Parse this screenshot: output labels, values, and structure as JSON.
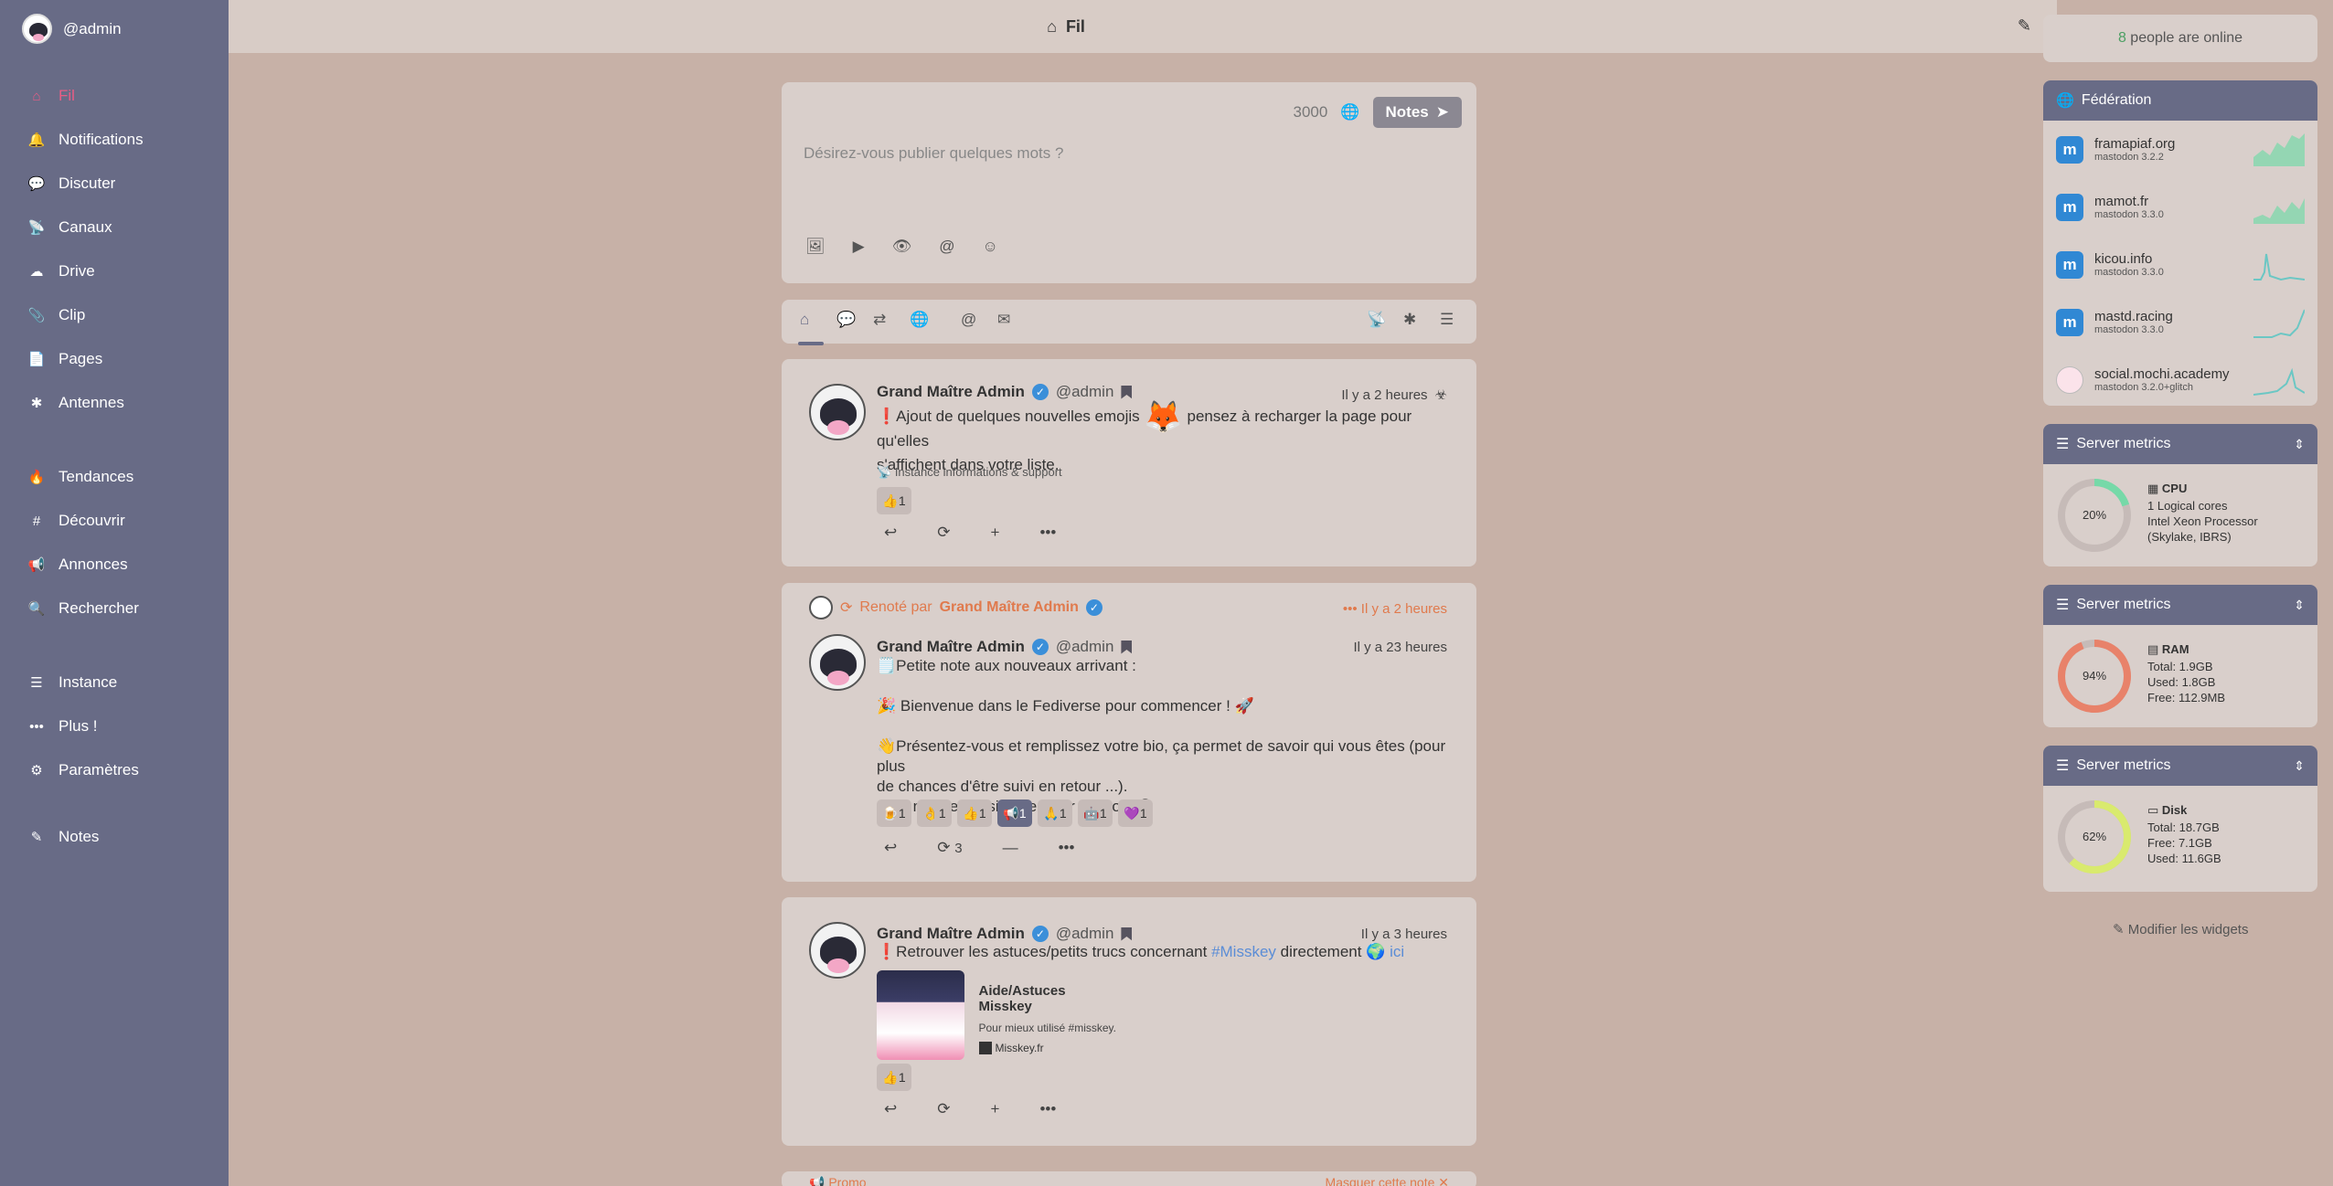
{
  "sidebar": {
    "account": "@admin",
    "items": [
      {
        "label": "Fil",
        "icon": "home-icon",
        "glyph": "⌂"
      },
      {
        "label": "Notifications",
        "icon": "bell-icon",
        "glyph": "🔔"
      },
      {
        "label": "Discuter",
        "icon": "chat-icon",
        "glyph": "💬"
      },
      {
        "label": "Canaux",
        "icon": "satellite-icon",
        "glyph": "📡"
      },
      {
        "label": "Drive",
        "icon": "cloud-icon",
        "glyph": "☁"
      },
      {
        "label": "Clip",
        "icon": "paperclip-icon",
        "glyph": "📎"
      },
      {
        "label": "Pages",
        "icon": "file-icon",
        "glyph": "📄"
      },
      {
        "label": "Antennes",
        "icon": "antenna-icon",
        "glyph": "✱"
      },
      {
        "label": "Tendances",
        "icon": "fire-icon",
        "glyph": "🔥"
      },
      {
        "label": "Découvrir",
        "icon": "hashtag-icon",
        "glyph": "#"
      },
      {
        "label": "Annonces",
        "icon": "broadcast-icon",
        "glyph": "📢"
      },
      {
        "label": "Rechercher",
        "icon": "search-icon",
        "glyph": "🔍"
      },
      {
        "label": "Instance",
        "icon": "server-icon",
        "glyph": "☰"
      },
      {
        "label": "Plus !",
        "icon": "more-icon",
        "glyph": "•••"
      },
      {
        "label": "Paramètres",
        "icon": "gear-icon",
        "glyph": "⚙"
      },
      {
        "label": "Notes",
        "icon": "pencil-icon",
        "glyph": "✎"
      }
    ]
  },
  "header": {
    "title": "Fil",
    "home_glyph": "⌂",
    "pencil_glyph": "✎"
  },
  "composer": {
    "chars": "3000",
    "globe": "🌐",
    "button": "Notes",
    "send": "➤",
    "placeholder": "Désirez-vous publier quelques mots ?",
    "tools": [
      "🖼",
      "▶",
      "👁",
      "@",
      "☺"
    ]
  },
  "timeline_tabs": {
    "glyphs": [
      "⌂",
      "💬",
      "⇄",
      "🌐",
      "@",
      "✉",
      "📡",
      "✱",
      "☰"
    ]
  },
  "notes": [
    {
      "name": "Grand Maître Admin",
      "handle": "@admin",
      "time": "Il y a 2 heures",
      "time_icon": "☣",
      "text_a": "❗Ajout de quelques nouvelles emojis",
      "emoji": "🦊",
      "text_b": "pensez à recharger la page pour qu'elles",
      "text_c": "s'affichent dans votre liste.",
      "channel": "Instance informations & support",
      "reaction": "👍1"
    },
    {
      "renote_label": "Renoté par",
      "renote_by": "Grand Maître Admin",
      "renote_time": "••• Il y a 2 heures",
      "name": "Grand Maître Admin",
      "handle": "@admin",
      "time": "Il y a 23 heures",
      "lines": [
        "🗒️Petite note aux nouveaux arrivant :",
        "",
        "🎉 Bienvenue dans le Fediverse pour commencer ! 🚀",
        "",
        "👋Présentez-vous et remplissez votre bio, ça permet de savoir qui vous êtes (pour plus",
        "de chances d'être suivi en retour ...).",
        "Cela m'aide aussi à identifier les bots 😉"
      ],
      "reactions": [
        "🍺1",
        "👌1",
        "👍1",
        "📢1",
        "🙏1",
        "🤖1",
        "💜1"
      ],
      "renote_count": "3"
    },
    {
      "name": "Grand Maître Admin",
      "handle": "@admin",
      "time": "Il y a 3 heures",
      "text_a": "❗Retrouver les astuces/petits trucs concernant",
      "hashtag": "#Misskey",
      "text_b": "directement",
      "link": "🌍 ici",
      "card_title": "Aide/Astuces Misskey",
      "card_desc": "Pour mieux utilisé #misskey.",
      "card_site": "Misskey.fr",
      "reaction": "👍1"
    }
  ],
  "banner": {
    "left": "📢 Promo",
    "right": "Masquer cette note ✕"
  },
  "widgets": {
    "online_count": "8",
    "online_text": "people are online",
    "federation_title": "Fédération",
    "federation": [
      {
        "name": "framapiaf.org",
        "version": "mastodon 3.2.2",
        "color": "#76d9a8"
      },
      {
        "name": "mamot.fr",
        "version": "mastodon 3.3.0",
        "color": "#76d9a8"
      },
      {
        "name": "kicou.info",
        "version": "mastodon 3.3.0",
        "color": "#6bc7c4"
      },
      {
        "name": "mastd.racing",
        "version": "mastodon 3.3.0",
        "color": "#6bc7c4"
      },
      {
        "name": "social.mochi.academy",
        "version": "mastodon 3.2.0+glitch",
        "color": "#6bc7c4"
      }
    ],
    "metrics": [
      {
        "title": "Server metrics",
        "pct": "20%",
        "fraction": 0.2,
        "color": "#76d9a8",
        "head": "CPU",
        "lines": [
          "1 Logical cores",
          "Intel Xeon Processor",
          "(Skylake, IBRS)"
        ]
      },
      {
        "title": "Server metrics",
        "pct": "94%",
        "fraction": 0.94,
        "color": "#e8826a",
        "head": "RAM",
        "lines": [
          "Total: 1.9GB",
          "Used: 1.8GB",
          "Free: 112.9MB"
        ]
      },
      {
        "title": "Server metrics",
        "pct": "62%",
        "fraction": 0.62,
        "color": "#d9ea6e",
        "head": "Disk",
        "lines": [
          "Total: 18.7GB",
          "Free: 7.1GB",
          "Used: 11.6GB"
        ]
      }
    ],
    "modify": "✎ Modifier les widgets"
  }
}
